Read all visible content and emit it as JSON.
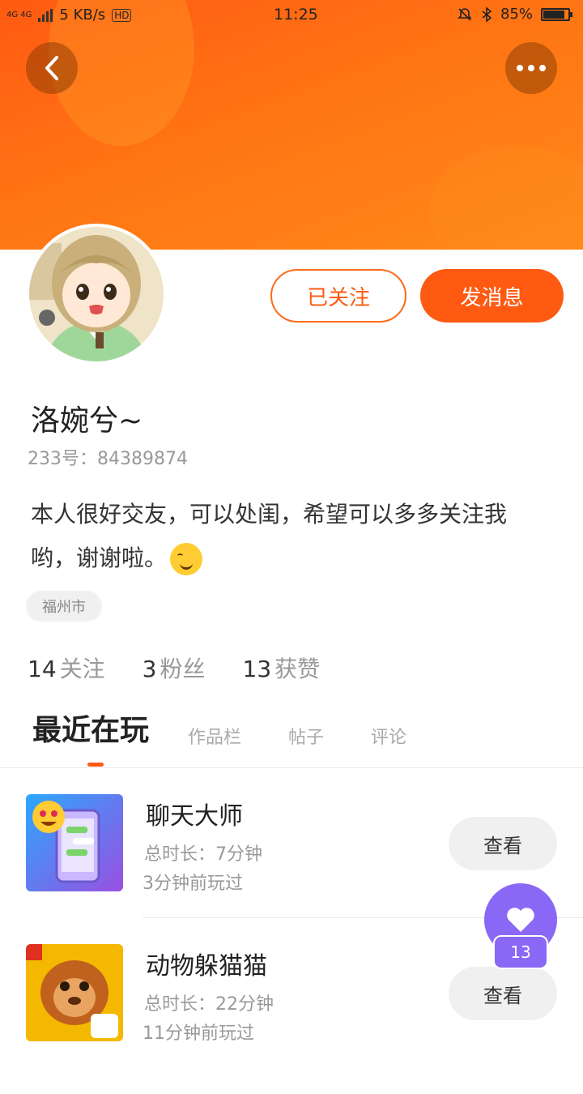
{
  "status_bar": {
    "network": "4G 4G",
    "speed": "5 KB/s",
    "hd": "HD",
    "time": "11:25",
    "battery": "85%",
    "battery_level": 0.85
  },
  "header": {
    "back_icon": "chevron-left-icon",
    "more_icon": "more-dots-icon"
  },
  "profile": {
    "follow_label": "已关注",
    "message_label": "发消息",
    "name": "洛婉兮~",
    "id_line": "233号：84389874",
    "bio_text": "本人很好交友，可以处闺，希望可以多多关注我哟，谢谢啦。",
    "bio_emoji": "smiling-face-emoji",
    "city": "福州市"
  },
  "stats": [
    {
      "num": "14",
      "label": "关注"
    },
    {
      "num": "3",
      "label": "粉丝"
    },
    {
      "num": "13",
      "label": "获赞"
    }
  ],
  "tabs": [
    {
      "label": "最近在玩",
      "active": true
    },
    {
      "label": "作品栏",
      "active": false
    },
    {
      "label": "帖子",
      "active": false
    },
    {
      "label": "评论",
      "active": false
    }
  ],
  "games": [
    {
      "title": "聊天大师",
      "duration": "总时长：7分钟",
      "ago": "3分钟前玩过",
      "view_label": "查看"
    },
    {
      "title": "动物躲猫猫",
      "duration": "总时长：22分钟",
      "ago": "11分钟前玩过",
      "view_label": "查看"
    }
  ],
  "fab": {
    "icon": "heart-icon",
    "count": "13"
  },
  "colors": {
    "accent": "#ff5a12",
    "fab": "#8a68f5"
  }
}
